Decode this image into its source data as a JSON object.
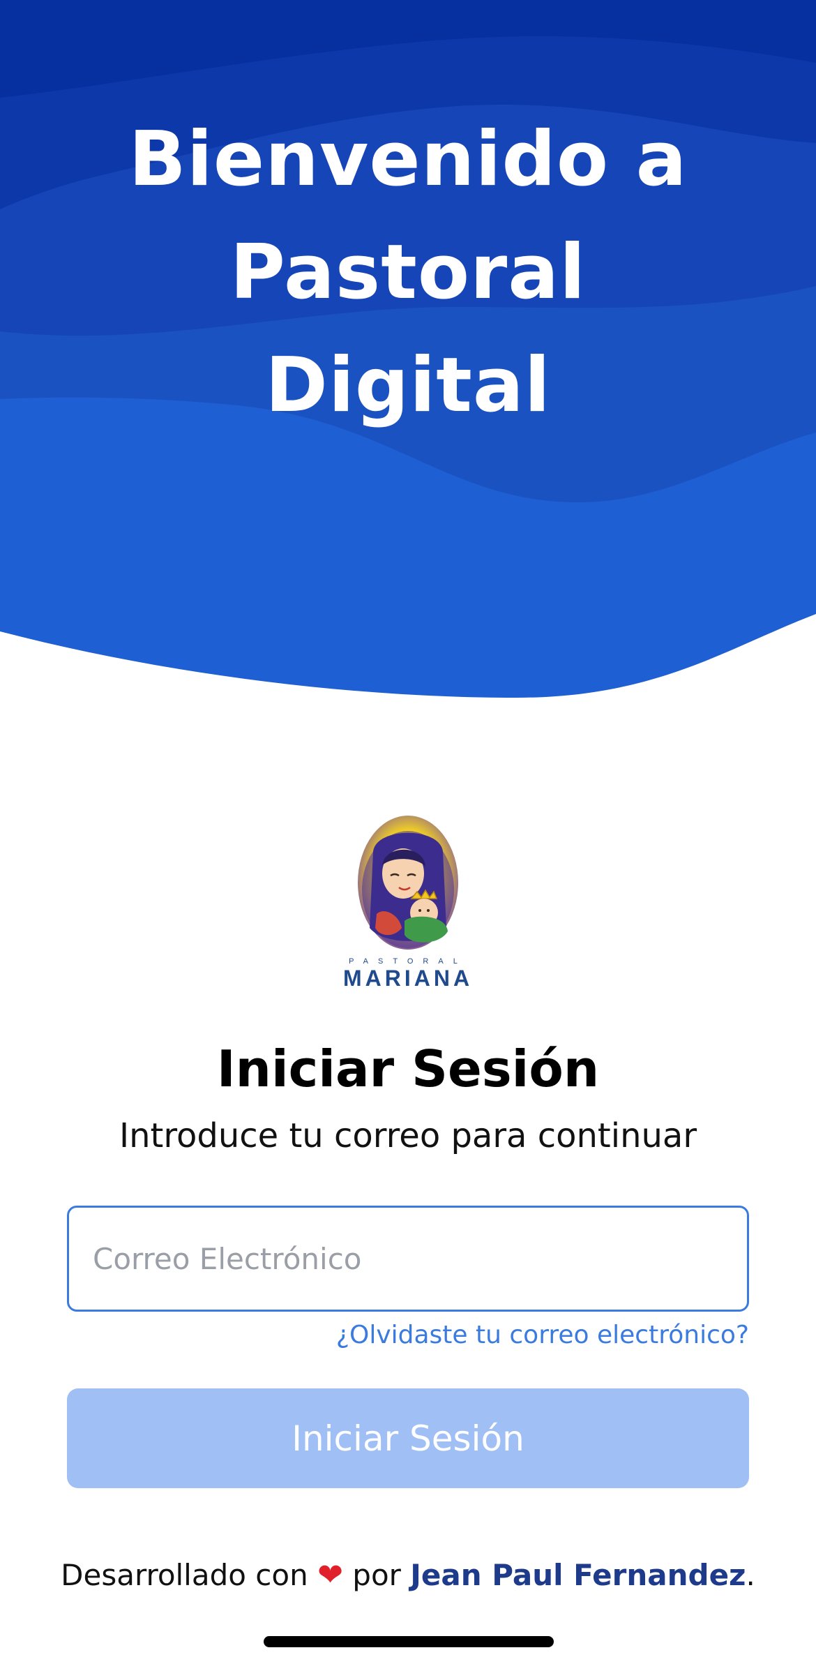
{
  "hero": {
    "title_lines": [
      "Bienvenido a",
      "Pastoral",
      "Digital"
    ]
  },
  "logo": {
    "small_text": "PASTORAL",
    "big_text": "MARIANA",
    "icon": "virgin-mary-child-illustration"
  },
  "login": {
    "title": "Iniciar Sesión",
    "subtitle": "Introduce tu correo para continuar",
    "email_placeholder": "Correo Electrónico",
    "email_value": "",
    "forgot_label": "¿Olvidaste tu correo electrónico?",
    "button_label": "Iniciar Sesión"
  },
  "footer": {
    "prefix": "Desarrollado con",
    "heart": "❤",
    "middle": "por",
    "author": "Jean Paul Fernandez",
    "suffix": "."
  },
  "colors": {
    "hero_dark": "#0630a0",
    "hero_mid": "#1645b8",
    "hero_light": "#1e5fd3",
    "accent": "#3b7be0",
    "button_disabled": "#9fbff5",
    "author": "#1e3a8a"
  }
}
